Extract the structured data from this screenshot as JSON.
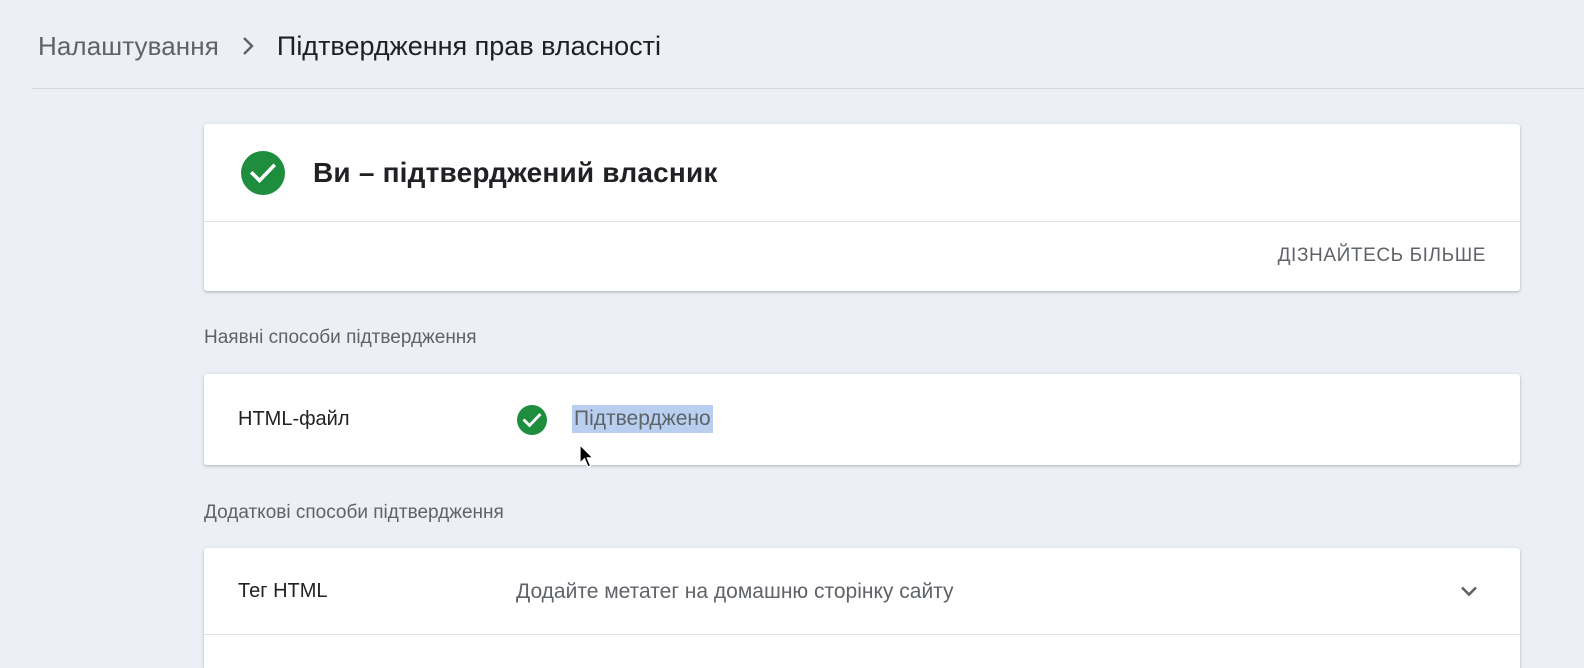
{
  "breadcrumb": {
    "parent": "Налаштування",
    "separator_icon": "chevron-right-icon",
    "current": "Підтвердження прав власності"
  },
  "owner_card": {
    "icon": "check-circle-icon",
    "title": "Ви – підтверджений власник",
    "learn_more": "ДІЗНАЙТЕСЬ БІЛЬШЕ"
  },
  "existing_methods": {
    "label": "Наявні способи підтвердження",
    "items": [
      {
        "name": "HTML-файл",
        "status_icon": "check-circle-icon",
        "status": "Підтверджено"
      }
    ]
  },
  "additional_methods": {
    "label": "Додаткові способи підтвердження",
    "items": [
      {
        "name": "Тег HTML",
        "description": "Додайте метатег на домашню сторінку сайту",
        "expand_icon": "chevron-down-icon"
      }
    ]
  },
  "colors": {
    "success": "#1e8e3e",
    "background": "#eceff5",
    "selection": "#b8cff0"
  }
}
